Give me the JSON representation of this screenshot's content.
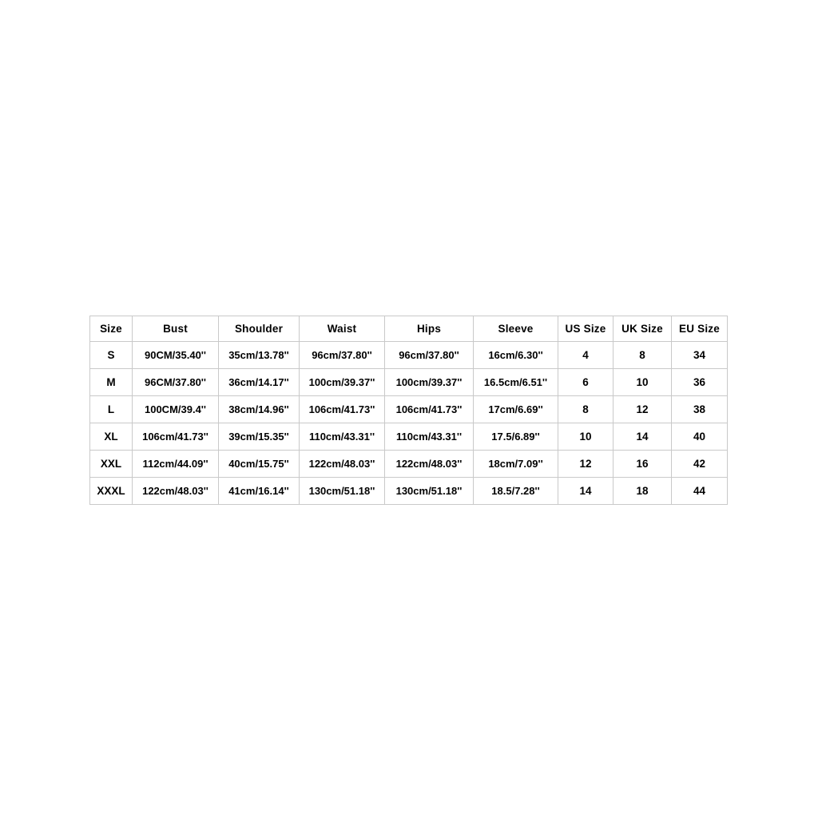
{
  "table": {
    "columns": [
      {
        "key": "size",
        "label": "Size"
      },
      {
        "key": "bust",
        "label": "Bust"
      },
      {
        "key": "shoulder",
        "label": "Shoulder"
      },
      {
        "key": "waist",
        "label": "Waist"
      },
      {
        "key": "hips",
        "label": "Hips"
      },
      {
        "key": "sleeve",
        "label": "Sleeve"
      },
      {
        "key": "us",
        "label": "US Size"
      },
      {
        "key": "uk",
        "label": "UK Size"
      },
      {
        "key": "eu",
        "label": "EU Size"
      }
    ],
    "rows": [
      {
        "size": "S",
        "bust": "90CM/35.40''",
        "shoulder": "35cm/13.78''",
        "waist": "96cm/37.80''",
        "hips": "96cm/37.80''",
        "sleeve": "16cm/6.30''",
        "us": "4",
        "uk": "8",
        "eu": "34"
      },
      {
        "size": "M",
        "bust": "96CM/37.80''",
        "shoulder": "36cm/14.17''",
        "waist": "100cm/39.37''",
        "hips": "100cm/39.37''",
        "sleeve": "16.5cm/6.51''",
        "us": "6",
        "uk": "10",
        "eu": "36"
      },
      {
        "size": "L",
        "bust": "100CM/39.4''",
        "shoulder": "38cm/14.96''",
        "waist": "106cm/41.73''",
        "hips": "106cm/41.73''",
        "sleeve": "17cm/6.69''",
        "us": "8",
        "uk": "12",
        "eu": "38"
      },
      {
        "size": "XL",
        "bust": "106cm/41.73''",
        "shoulder": "39cm/15.35''",
        "waist": "110cm/43.31''",
        "hips": "110cm/43.31''",
        "sleeve": "17.5/6.89''",
        "us": "10",
        "uk": "14",
        "eu": "40"
      },
      {
        "size": "XXL",
        "bust": "112cm/44.09''",
        "shoulder": "40cm/15.75''",
        "waist": "122cm/48.03''",
        "hips": "122cm/48.03''",
        "sleeve": "18cm/7.09''",
        "us": "12",
        "uk": "16",
        "eu": "42"
      },
      {
        "size": "XXXL",
        "bust": "122cm/48.03''",
        "shoulder": "41cm/16.14''",
        "waist": "130cm/51.18''",
        "hips": "130cm/51.18''",
        "sleeve": "18.5/7.28''",
        "us": "14",
        "uk": "18",
        "eu": "44"
      }
    ]
  },
  "colors": {
    "background": "#ffffff",
    "text": "#000000",
    "border": "#c9c9c9"
  }
}
